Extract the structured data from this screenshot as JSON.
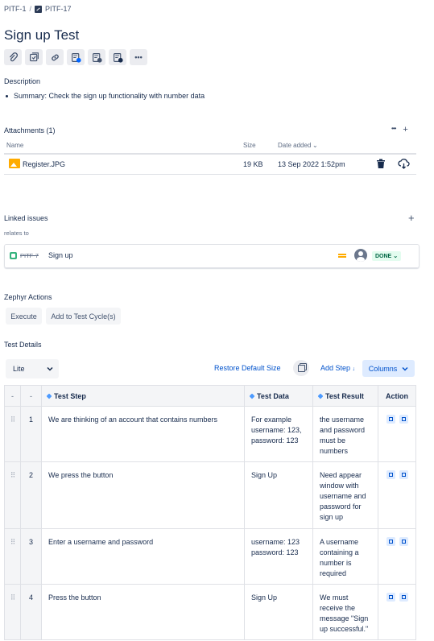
{
  "breadcrumb": {
    "parent": "PITF-1",
    "separator": "/",
    "current": "PITF-17"
  },
  "title": "Sign up Test",
  "toolbar": {
    "icons": [
      "attach-icon",
      "checklist-icon",
      "link-icon",
      "test-add-icon",
      "test-step-icon",
      "test-run-icon"
    ],
    "more": "•••"
  },
  "description": {
    "label": "Description",
    "summary": "Summary: Check the sign up functionality with number data"
  },
  "attachments": {
    "label": "Attachments (1)",
    "more": "•••",
    "add": "+",
    "columns": {
      "name": "Name",
      "size": "Size",
      "date": "Date added"
    },
    "files": [
      {
        "name": "Register.JPG",
        "size": "19 KB",
        "date": "13 Sep 2022 1:52pm"
      }
    ]
  },
  "linked": {
    "label": "Linked issues",
    "add": "+",
    "relation": "relates to",
    "issue": {
      "key": "PITF-7",
      "summary": "Sign up",
      "status": "DONE"
    }
  },
  "zephyr": {
    "label": "Zephyr Actions",
    "execute": "Execute",
    "add_cycle": "Add to Test Cycle(s)"
  },
  "test_details": {
    "label": "Test Details",
    "view": "Lite",
    "restore": "Restore Default Size",
    "add_step": "Add Step",
    "columns_btn": "Columns",
    "headers": {
      "dash1": "-",
      "dash2": "-",
      "step": "Test Step",
      "data": "Test Data",
      "result": "Test Result",
      "action": "Action"
    },
    "rows": [
      {
        "num": "1",
        "step": "We are thinking of an account that contains numbers",
        "data": "For example username: 123, password: 123",
        "result": "the username and password must be numbers"
      },
      {
        "num": "2",
        "step": "We press the button",
        "data": "Sign Up",
        "result": "Need appear window with username and password for sign up"
      },
      {
        "num": "3",
        "step": "Enter a username and password",
        "data": "username: 123 password: 123",
        "result": "A username containing a number is required"
      },
      {
        "num": "4",
        "step": "Press the button",
        "data": "Sign Up",
        "result": "We must receive the message \"Sign up successful.\""
      }
    ]
  },
  "colors": {
    "link": "#0052CC",
    "done_bg": "#E3FCEF",
    "done_text": "#006644",
    "image_icon": "#FFAB00"
  }
}
